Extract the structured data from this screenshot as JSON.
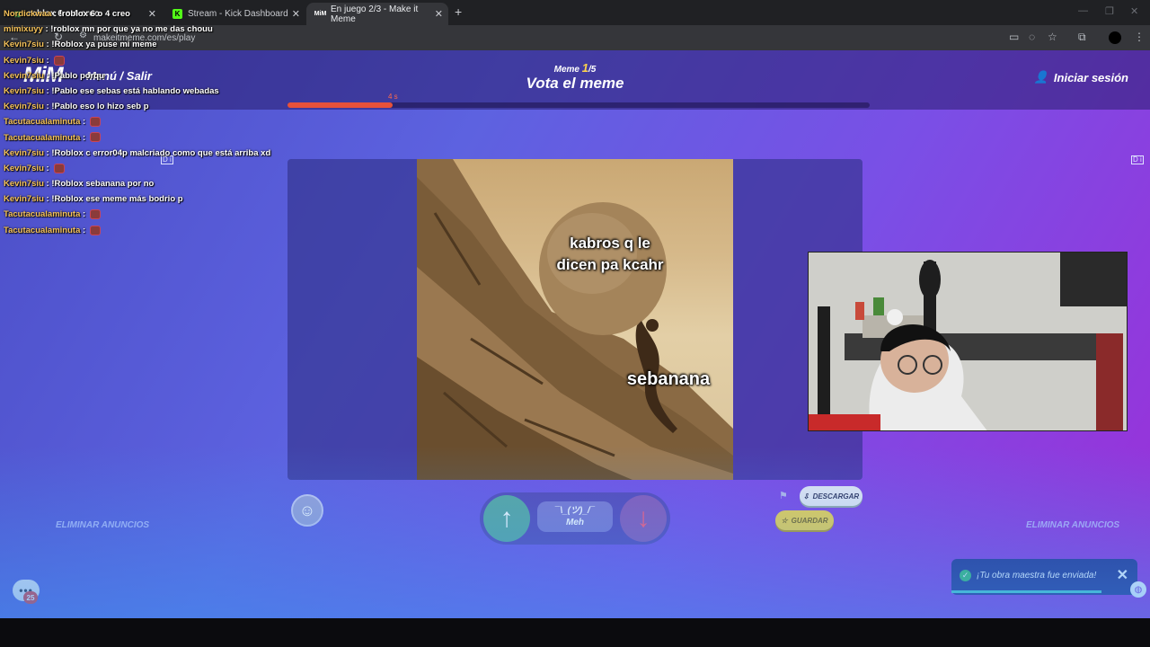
{
  "browser": {
    "tabs": [
      {
        "label": "roblox 6 o 4 creo",
        "active": false
      },
      {
        "label": "Stream - Kick Dashboard",
        "active": false
      },
      {
        "label": "En juego 2/3 - Make it Meme",
        "active": true
      }
    ],
    "url": "makeitmeme.com/es/play",
    "new_tab": "+"
  },
  "header": {
    "logo": "MiM",
    "menu_label": "Menú / Salir",
    "meme_counter_prefix": "Meme",
    "meme_current": "1",
    "meme_total": "/5",
    "title": "Vota el meme",
    "login_label": "Iniciar sesión",
    "timer_label": "4 s",
    "timer_progress_fraction": 0.18
  },
  "meme": {
    "caption_top": "kabros q le dicen pa kcahr",
    "caption_bottom": "sebanana"
  },
  "voting": {
    "up_icon": "↑",
    "down_icon": "↓",
    "meh_face": "¯\\_(ツ)_/¯",
    "meh_label": "Meh"
  },
  "actions": {
    "download_label": "DESCARGAR",
    "save_label": "GUARDAR",
    "remove_ads_left": "ELIMINAR ANUNCIOS",
    "remove_ads_right": "ELIMINAR ANUNCIOS"
  },
  "toast": {
    "message": "¡Tu obra maestra fue enviada!",
    "close": "✕"
  },
  "chat_widget": {
    "badge_count": "25"
  },
  "chat_overlay": [
    {
      "user": "Nordickwaa",
      "msg": ": !roblox 6 o 4 creo",
      "emote": false
    },
    {
      "user": "mimixuyy",
      "msg": ": !roblox mn por que ya no me das chouu",
      "emote": false
    },
    {
      "user": "Kevin7siu",
      "msg": ": !Roblox ya puse mi meme",
      "emote": false
    },
    {
      "user": "Kevin7siu",
      "msg": ":",
      "emote": true
    },
    {
      "user": "Kevin7siu",
      "msg": ": !Pablo porqu",
      "emote": false
    },
    {
      "user": "Kevin7siu",
      "msg": ": !Pablo ese sebas está hablando webadas",
      "emote": false
    },
    {
      "user": "Kevin7siu",
      "msg": ": !Pablo eso lo hizo seb p",
      "emote": false
    },
    {
      "user": "Tacutacualaminuta",
      "msg": ":",
      "emote": true
    },
    {
      "user": "Tacutacualaminuta",
      "msg": ":",
      "emote": true
    },
    {
      "user": "Kevin7siu",
      "msg": ": !Roblox c error04p malcriado como que está arriba xd",
      "emote": false
    },
    {
      "user": "Kevin7siu",
      "msg": ":",
      "emote": true
    },
    {
      "user": "Kevin7siu",
      "msg": ": !Roblox sebanana por no",
      "emote": false
    },
    {
      "user": "Kevin7siu",
      "msg": ": !Roblox ese meme más bodrio p",
      "emote": false
    },
    {
      "user": "Tacutacualaminuta",
      "msg": ":",
      "emote": true
    },
    {
      "user": "Tacutacualaminuta",
      "msg": ":",
      "emote": true
    }
  ]
}
